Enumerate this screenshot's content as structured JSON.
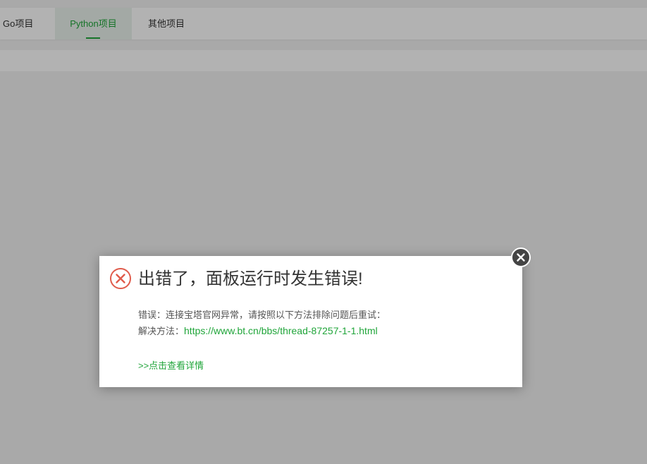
{
  "tabs": [
    {
      "label": "Go项目"
    },
    {
      "label": "Python项目",
      "active": true
    },
    {
      "label": "其他项目"
    }
  ],
  "dialog": {
    "title": "出错了，面板运行时发生错误!",
    "message_line1": "错误：连接宝塔官网异常，请按照以下方法排除问题后重试：",
    "solution_label": "解决方法：",
    "solution_link": "https://www.bt.cn/bbs/thread-87257-1-1.html",
    "details_link": ">>点击查看详情",
    "icon": "error-circle-x-icon",
    "close_icon": "close-icon"
  },
  "colors": {
    "accent": "#20a53a",
    "error": "#e05c4c",
    "overlay": "rgba(0,0,0,0.30)"
  }
}
